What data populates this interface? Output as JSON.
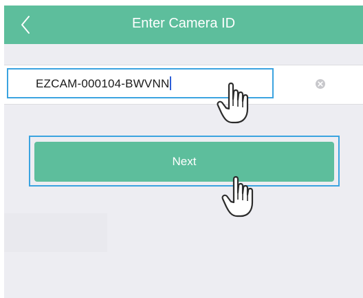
{
  "header": {
    "title": "Enter Camera ID",
    "back_icon": "chevron-left-icon"
  },
  "camera_id_field": {
    "value": "EZCAM-000104-BWVNN",
    "clear_icon": "clear-circle-icon"
  },
  "next_button": {
    "label": "Next"
  },
  "annotations": {
    "pointer_icon": "hand-pointer-icon"
  },
  "colors": {
    "accent": "#5dbe9c",
    "highlight_box": "#3aa3e0",
    "background": "#ededf2"
  }
}
